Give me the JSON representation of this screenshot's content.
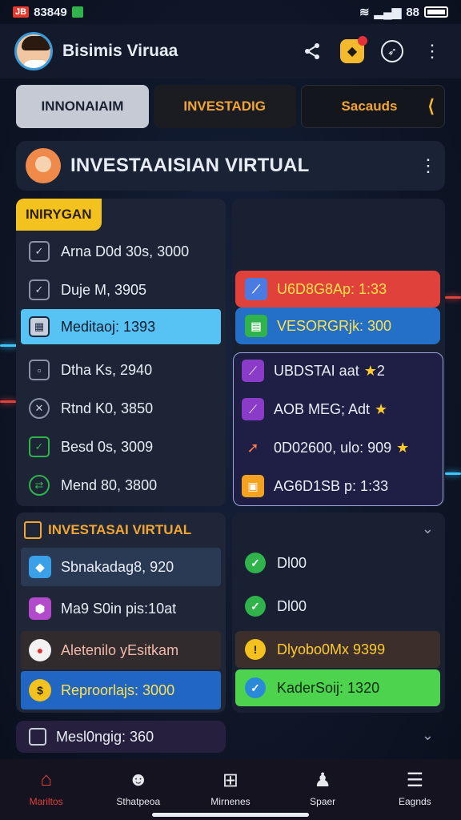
{
  "status": {
    "left_badge": "JB",
    "time": "83849",
    "right_time": "88"
  },
  "header": {
    "title": "Bisimis Viruaa"
  },
  "tabs": [
    {
      "label": "INNONAIAIM"
    },
    {
      "label": "INVESTADIG"
    },
    {
      "label": "Sacauds"
    }
  ],
  "section": {
    "title": "INVESTAAISIAN VIRTUAL"
  },
  "panelA": {
    "tag": "INIRYGAN",
    "rows": [
      {
        "label": "Arna D0d 30s, 3000"
      },
      {
        "label": "Duje M, 3905"
      },
      {
        "label": "Meditaoj: 1393"
      },
      {
        "label": "Dtha Ks, 2940"
      },
      {
        "label": "Rtnd K0, 3850"
      },
      {
        "label": "Besd 0s, 3009"
      },
      {
        "label": "Mend 80, 3800"
      }
    ]
  },
  "panelB": {
    "rows": [
      {
        "label": "U6D8G8Ap: 1:33"
      },
      {
        "label": "VESORGRjk: 300"
      }
    ],
    "outlined": [
      {
        "label": "UBDSTAI aat"
      },
      {
        "label": "AOB MEG; Adt"
      },
      {
        "label": "0D02600, ulo: 909"
      },
      {
        "label": "AG6D1SB p: 1:33"
      }
    ]
  },
  "panelC": {
    "header": "INVESTASAI VIRTUAL",
    "rows": [
      {
        "label": "Sbnakadag8, 920"
      },
      {
        "label": "Ma9 S0in pis:10at"
      },
      {
        "label": "Aletenilo yEsitkam"
      },
      {
        "label": "Reproorlajs: 3000"
      }
    ]
  },
  "panelD": {
    "rows": [
      {
        "label": "Dl00"
      },
      {
        "label": "Dl00"
      },
      {
        "label": "Dlyobo0Mx 9399"
      },
      {
        "label": "KaderSoij: 1320"
      }
    ]
  },
  "panelE": {
    "label": "Mesl0ngig: 360"
  },
  "nav": [
    {
      "label": "Mariltos"
    },
    {
      "label": "Sthatpeoa"
    },
    {
      "label": "Mirnenes"
    },
    {
      "label": "Spaer"
    },
    {
      "label": "Eagnds"
    }
  ]
}
